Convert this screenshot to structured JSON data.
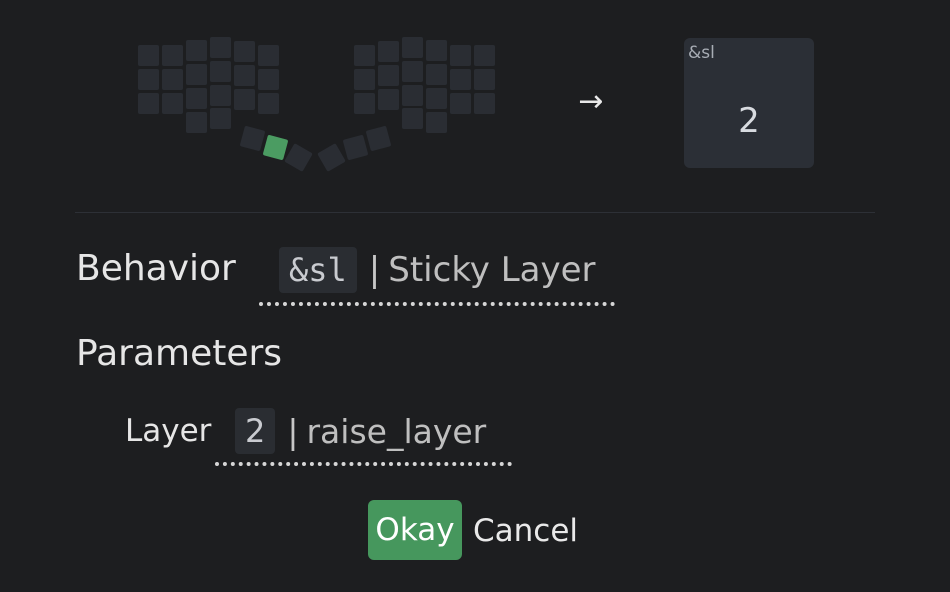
{
  "arrow_icon": "right-arrow-icon",
  "keycap": {
    "header": "&sl",
    "param": "2"
  },
  "behavior": {
    "label": "Behavior",
    "code": "&sl",
    "separator": "|",
    "description": "Sticky Layer"
  },
  "parameters": {
    "label": "Parameters",
    "layer": {
      "label": "Layer",
      "value": "2",
      "separator": "|",
      "description": "raise_layer"
    }
  },
  "buttons": {
    "okay": "Okay",
    "cancel": "Cancel"
  },
  "colors": {
    "background": "#1d1e20",
    "key_inactive": "#2a2d33",
    "key_active": "#4b9c62",
    "okay_button": "#46975d"
  }
}
